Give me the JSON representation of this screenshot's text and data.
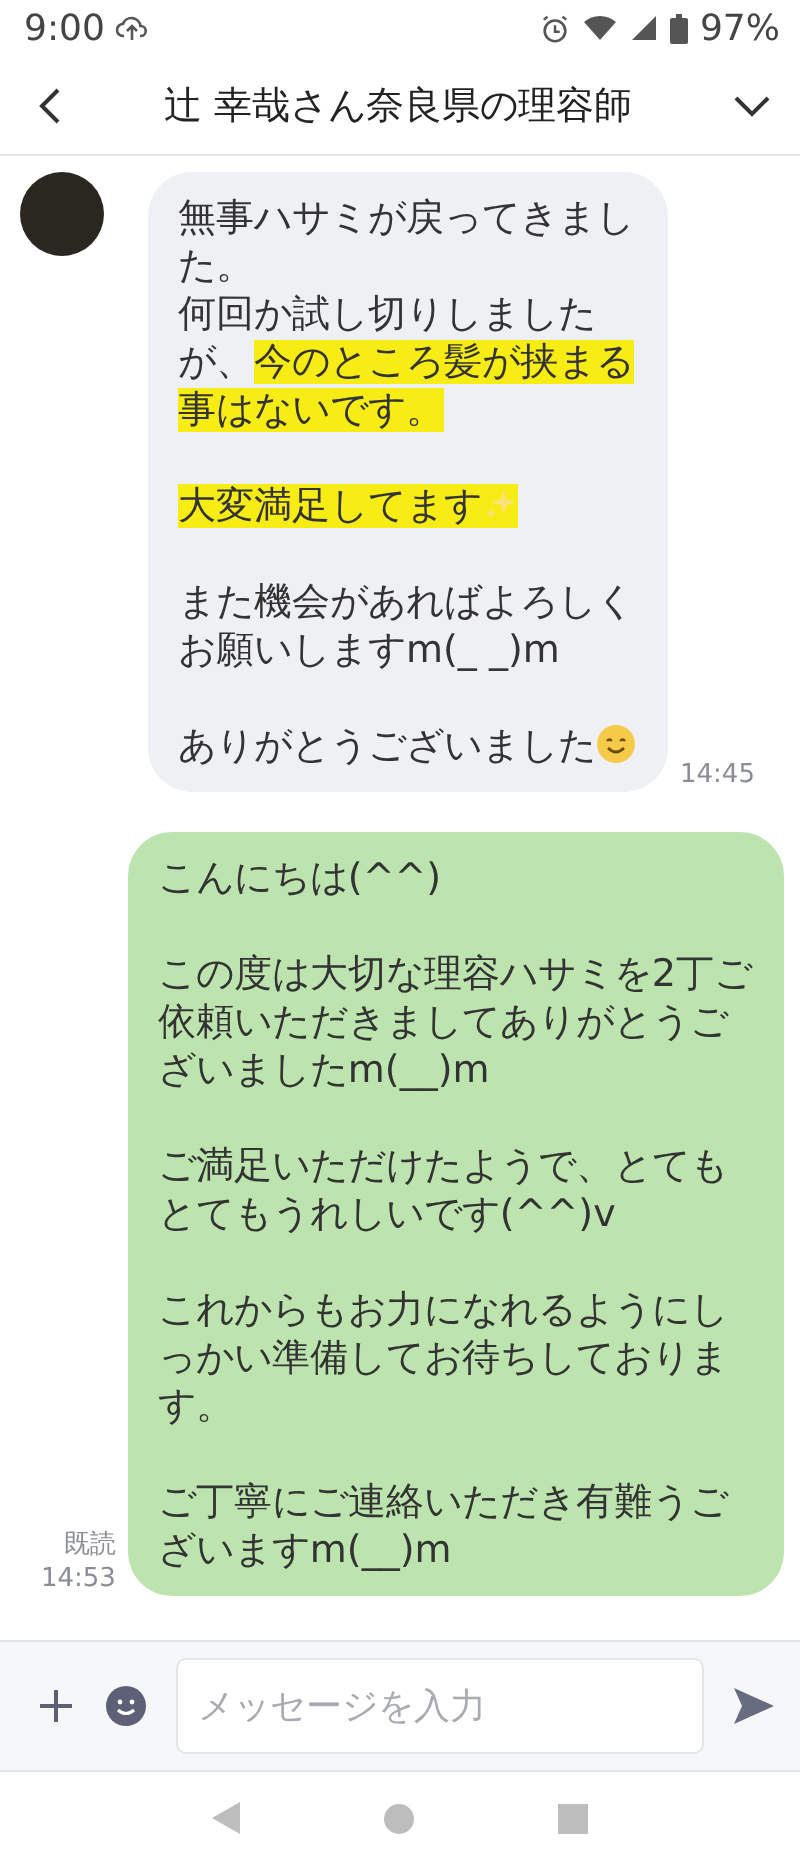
{
  "status_bar": {
    "time": "9:00",
    "battery": "97%"
  },
  "header": {
    "title": "辻 幸哉さん奈良県の理容師"
  },
  "messages": [
    {
      "kind": "received",
      "time": "14:45",
      "paragraphs": [
        [
          [
            {
              "text": "無事ハサミが戻ってきまし"
            }
          ],
          [
            {
              "text": "た。"
            }
          ],
          [
            {
              "text": "何回か試し切りしました"
            }
          ],
          [
            {
              "text": "が、"
            },
            {
              "text": "今のところ髪が挟まる",
              "highlighted": true
            }
          ],
          [
            {
              "text": "事はないです。",
              "highlighted": true
            }
          ]
        ],
        [
          [
            {
              "text": "大変満足してます",
              "highlighted": true
            },
            {
              "kind": "sparkles",
              "highlighted": true
            }
          ]
        ],
        [
          [
            {
              "text": "また機会があればよろしく"
            }
          ],
          [
            {
              "text": "お願いしますm(_ _)m"
            }
          ]
        ],
        [
          [
            {
              "text": "ありがとうございました"
            },
            {
              "kind": "smile"
            }
          ]
        ]
      ]
    },
    {
      "kind": "sent",
      "read": "既読",
      "time": "14:53",
      "paragraphs": [
        [
          [
            {
              "text": "こんにちは(^^)"
            }
          ]
        ],
        [
          [
            {
              "text": "この度は大切な理容ハサミを2丁ご"
            }
          ],
          [
            {
              "text": "依頼いただきましてありがとうご"
            }
          ],
          [
            {
              "text": "ざいましたm(__)m"
            }
          ]
        ],
        [
          [
            {
              "text": "ご満足いただけたようで、とても"
            }
          ],
          [
            {
              "text": "とてもうれしいです(^^)v"
            }
          ]
        ],
        [
          [
            {
              "text": "これからもお力になれるようにし"
            }
          ],
          [
            {
              "text": "っかい準備してお待ちしておりま"
            }
          ],
          [
            {
              "text": "す。"
            }
          ]
        ],
        [
          [
            {
              "text": "ご丁寧にご連絡いただき有難うご"
            }
          ],
          [
            {
              "text": "ざいますm(__)m"
            }
          ]
        ]
      ]
    }
  ],
  "composer": {
    "placeholder": "メッセージを入力"
  }
}
